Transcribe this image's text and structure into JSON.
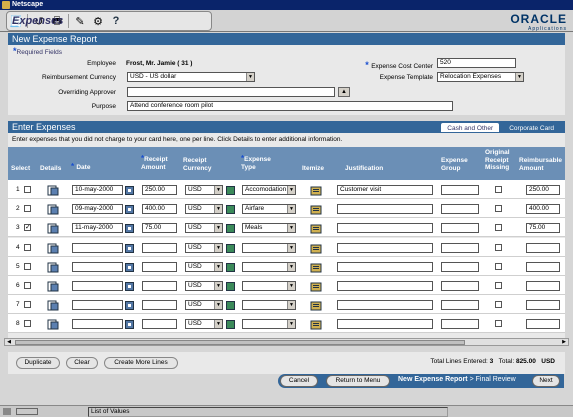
{
  "window_title": "Netscape",
  "app": {
    "tab_label": "Expenses"
  },
  "brand": {
    "name": "ORACLE",
    "sub": "Applications"
  },
  "header": {
    "title": "New Expense Report",
    "required_note": "Required Fields",
    "employee_label": "Employee",
    "employee_value": "Frost, Mr. Jamie ( 31 )",
    "currency_label": "Reimbursement Currency",
    "currency_value": "USD - US dollar",
    "approver_label": "Overriding Approver",
    "approver_value": "",
    "purpose_label": "Purpose",
    "purpose_value": "Attend conference room pilot",
    "cost_center_label": "Expense Cost Center",
    "cost_center_value": "520",
    "template_label": "Expense Template",
    "template_value": "Relocation Expenses"
  },
  "expenses": {
    "title": "Enter Expenses",
    "tab_cash": "Cash and Other",
    "tab_card": "Corporate Card",
    "instructions": "Enter expenses that you did not charge to your card here, one per line. Click Details to enter additional information.",
    "columns": {
      "select": "Select",
      "details": "Details",
      "date": "Date",
      "receipt_amount": [
        "Receipt",
        "Amount"
      ],
      "receipt_currency": [
        "Receipt",
        "Currency"
      ],
      "expense_type": [
        "Expense",
        "Type"
      ],
      "itemize": "Itemize",
      "justification": "Justification",
      "expense_group": [
        "Expense",
        "Group"
      ],
      "original_receipt_missing": [
        "Original",
        "Receipt",
        "Missing"
      ],
      "reimbursable_amount": [
        "Reimbursable",
        "Amount"
      ]
    },
    "rows": [
      {
        "num": "1",
        "selected": false,
        "date": "10-may-2000",
        "amount": "250.00",
        "currency": "USD",
        "type": "Accomodation",
        "justification": "Customer visit",
        "group": "",
        "missing": false,
        "reimb": "250.00"
      },
      {
        "num": "2",
        "selected": false,
        "date": "09-may-2000",
        "amount": "400.00",
        "currency": "USD",
        "type": "Airfare",
        "justification": "",
        "group": "",
        "missing": false,
        "reimb": "400.00"
      },
      {
        "num": "3",
        "selected": true,
        "date": "11-may-2000",
        "amount": "75.00",
        "currency": "USD",
        "type": "Meals",
        "justification": "",
        "group": "",
        "missing": false,
        "reimb": "75.00"
      },
      {
        "num": "4",
        "selected": false,
        "date": "",
        "amount": "",
        "currency": "USD",
        "type": "",
        "justification": "",
        "group": "",
        "missing": false,
        "reimb": ""
      },
      {
        "num": "5",
        "selected": false,
        "date": "",
        "amount": "",
        "currency": "USD",
        "type": "",
        "justification": "",
        "group": "",
        "missing": false,
        "reimb": ""
      },
      {
        "num": "6",
        "selected": false,
        "date": "",
        "amount": "",
        "currency": "USD",
        "type": "",
        "justification": "",
        "group": "",
        "missing": false,
        "reimb": ""
      },
      {
        "num": "7",
        "selected": false,
        "date": "",
        "amount": "",
        "currency": "USD",
        "type": "",
        "justification": "",
        "group": "",
        "missing": false,
        "reimb": ""
      },
      {
        "num": "8",
        "selected": false,
        "date": "",
        "amount": "",
        "currency": "USD",
        "type": "",
        "justification": "",
        "group": "",
        "missing": false,
        "reimb": ""
      }
    ]
  },
  "footer": {
    "duplicate": "Duplicate",
    "clear": "Clear",
    "create_more": "Create More Lines",
    "total_lines_label": "Total Lines Entered:",
    "total_lines_value": "3",
    "total_label": "Total:",
    "total_value": "825.00",
    "total_currency": "USD"
  },
  "nav": {
    "cancel": "Cancel",
    "return_menu": "Return to Menu",
    "step_current": "New Expense Report",
    "step_next": "> Final Review",
    "next": "Next"
  },
  "status": {
    "text": "List of Values"
  },
  "colors": {
    "section_blue": "#336699",
    "header_blue": "#6b8fb6",
    "title_bar": "#0a246a"
  }
}
